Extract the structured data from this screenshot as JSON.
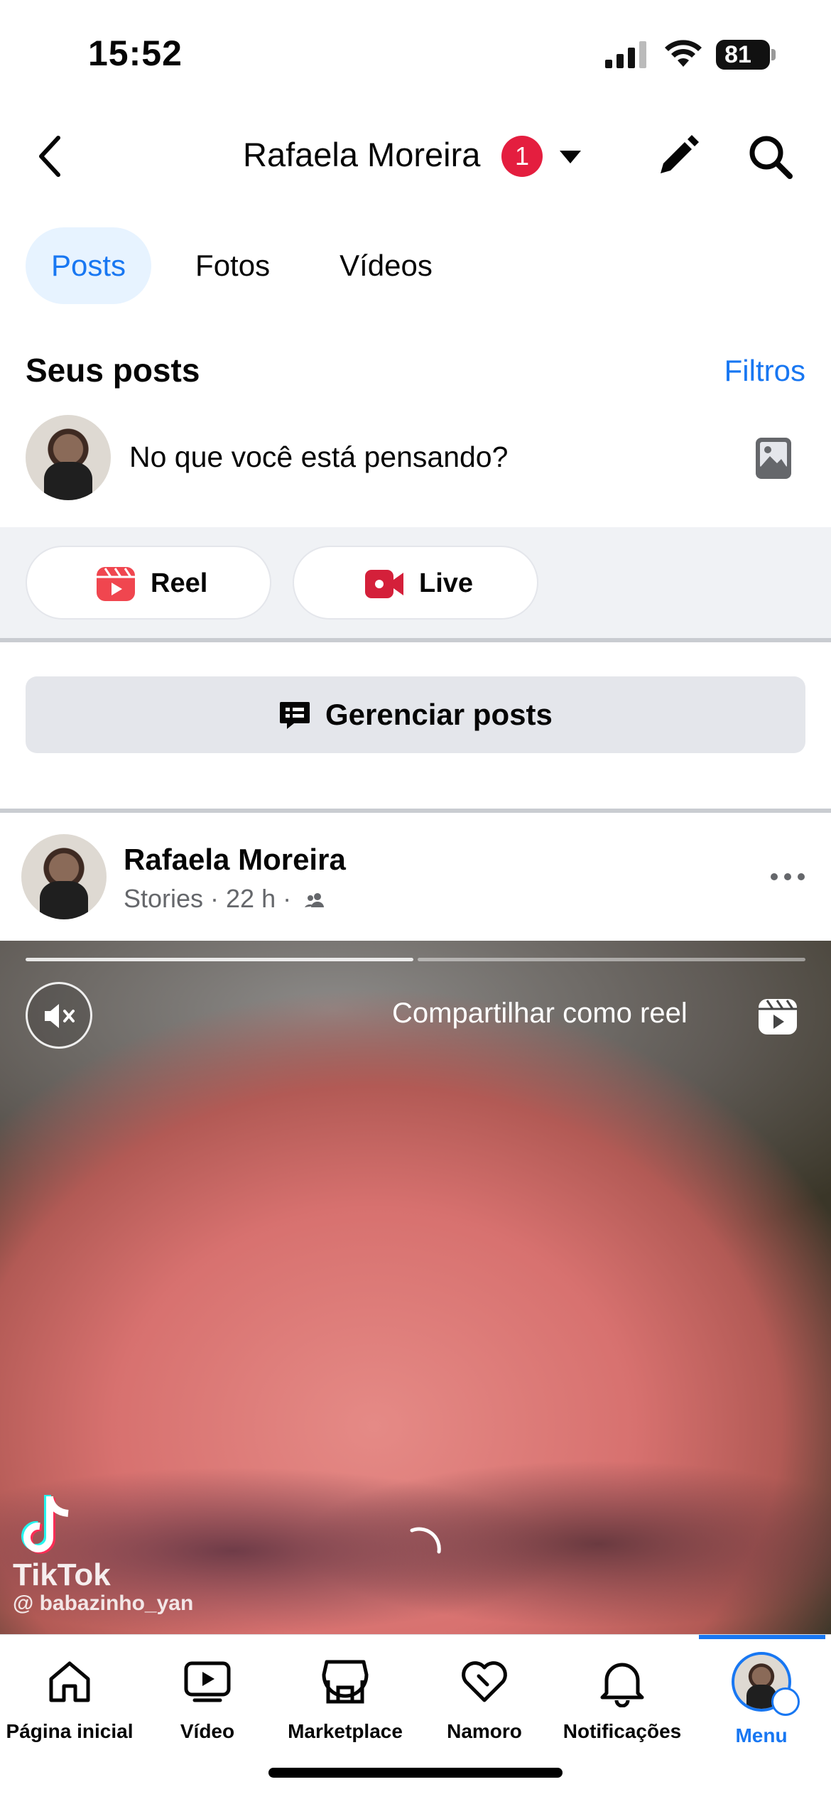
{
  "status_bar": {
    "time": "15:52",
    "battery": "81"
  },
  "header": {
    "title": "Rafaela Moreira",
    "notification_count": "1"
  },
  "tabs": [
    {
      "label": "Posts",
      "active": true
    },
    {
      "label": "Fotos",
      "active": false
    },
    {
      "label": "Vídeos",
      "active": false
    }
  ],
  "your_posts": {
    "title": "Seus posts",
    "filters_label": "Filtros",
    "composer_placeholder": "No que você está pensando?"
  },
  "actions": {
    "reel_label": "Reel",
    "live_label": "Live"
  },
  "manage_posts_label": "Gerenciar posts",
  "post": {
    "author": "Rafaela Moreira",
    "meta": "Stories · 22 h ·",
    "share_as_reel_label": "Compartilhar como reel",
    "watermark_brand": "TikTok",
    "watermark_handle": "@ babazinho_yan"
  },
  "bottom_nav": [
    {
      "label": "Página inicial",
      "icon": "home-icon"
    },
    {
      "label": "Vídeo",
      "icon": "video-icon"
    },
    {
      "label": "Marketplace",
      "icon": "marketplace-icon"
    },
    {
      "label": "Namoro",
      "icon": "dating-heart-icon"
    },
    {
      "label": "Notificações",
      "icon": "bell-icon"
    },
    {
      "label": "Menu",
      "icon": "menu-avatar",
      "active": true
    }
  ],
  "colors": {
    "accent": "#1877f2",
    "badge": "#e41e3f",
    "reel": "#f0464f",
    "live": "#d4203a"
  }
}
